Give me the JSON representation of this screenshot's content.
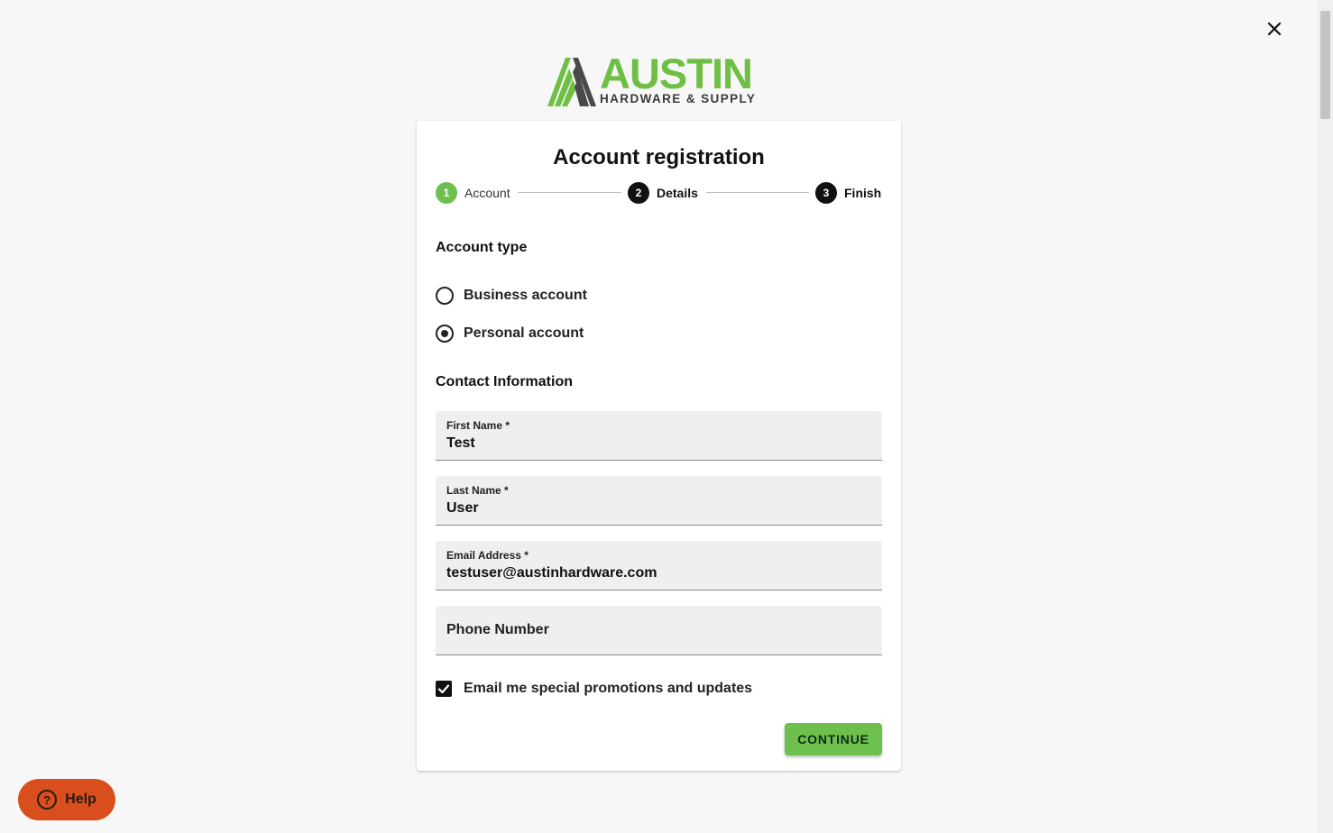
{
  "logo": {
    "brand": "AUSTIN",
    "tagline": "HARDWARE & SUPPLY",
    "brand_color": "#6fbf45"
  },
  "close_icon": "close-icon",
  "card": {
    "title": "Account registration"
  },
  "stepper": {
    "steps": [
      {
        "number": "1",
        "label": "Account",
        "color": "#6dbf4e",
        "state": "active"
      },
      {
        "number": "2",
        "label": "Details",
        "color": "#111111",
        "state": "pending"
      },
      {
        "number": "3",
        "label": "Finish",
        "color": "#111111",
        "state": "pending"
      }
    ]
  },
  "account_type": {
    "title": "Account type",
    "options": [
      {
        "label": "Business account",
        "selected": false
      },
      {
        "label": "Personal account",
        "selected": true
      }
    ]
  },
  "contact": {
    "title": "Contact Information",
    "fields": {
      "first_name": {
        "label": "First Name *",
        "value": "Test"
      },
      "last_name": {
        "label": "Last Name *",
        "value": "User"
      },
      "email": {
        "label": "Email Address *",
        "value": "testuser@austinhardware.com"
      },
      "phone": {
        "placeholder": "Phone Number",
        "value": ""
      }
    }
  },
  "promotions": {
    "label": "Email me special promotions and updates",
    "checked": true
  },
  "continue_label": "CONTINUE",
  "help": {
    "label": "Help",
    "icon": "question-circle-icon",
    "color": "#d84e1c"
  }
}
